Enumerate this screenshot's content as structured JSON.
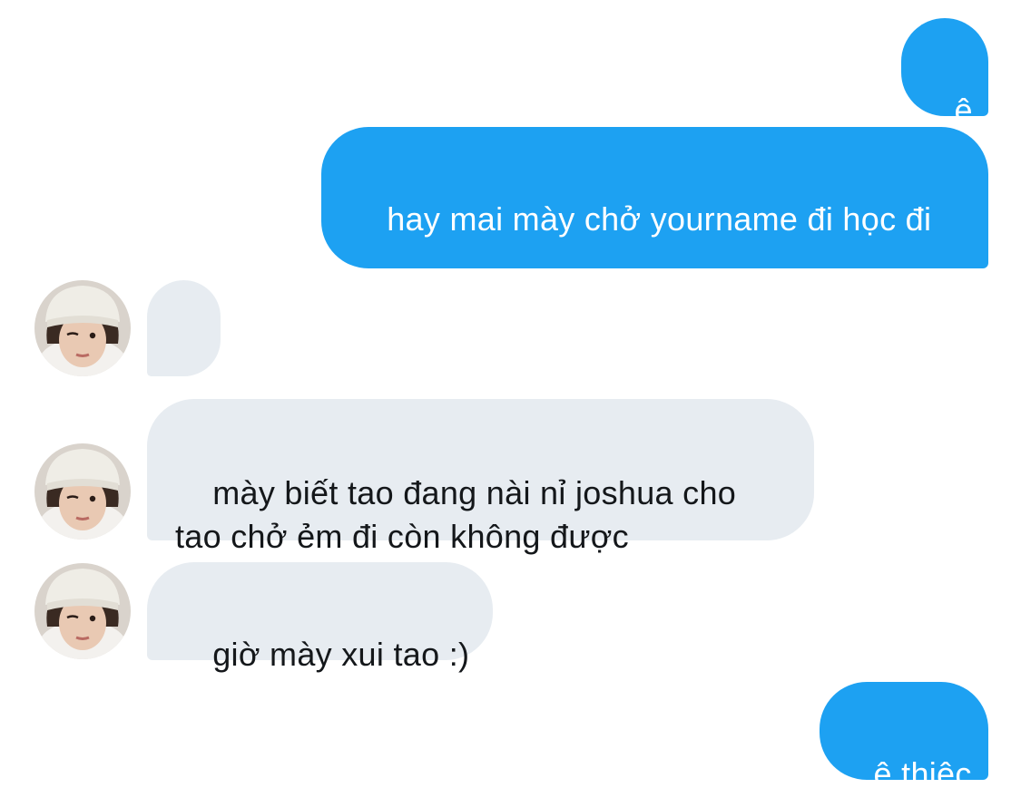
{
  "messages": [
    {
      "direction": "outgoing",
      "text": "ê"
    },
    {
      "direction": "outgoing",
      "text": "hay mai mày chở yourname đi học đi"
    },
    {
      "direction": "incoming",
      "text": "?"
    },
    {
      "direction": "incoming",
      "text": "mày biết tao đang nài nỉ joshua cho tao chở ẻm đi còn không được"
    },
    {
      "direction": "incoming",
      "text": "giờ mày xui tao :)"
    },
    {
      "direction": "outgoing",
      "text": "ê thiệc"
    }
  ],
  "colors": {
    "outgoing_bubble": "#1da1f2",
    "incoming_bubble": "#e7ecf1",
    "outgoing_text": "#ffffff",
    "incoming_text": "#14171a",
    "background": "#ffffff"
  },
  "avatar": {
    "icon": "profile-photo-avatar"
  }
}
